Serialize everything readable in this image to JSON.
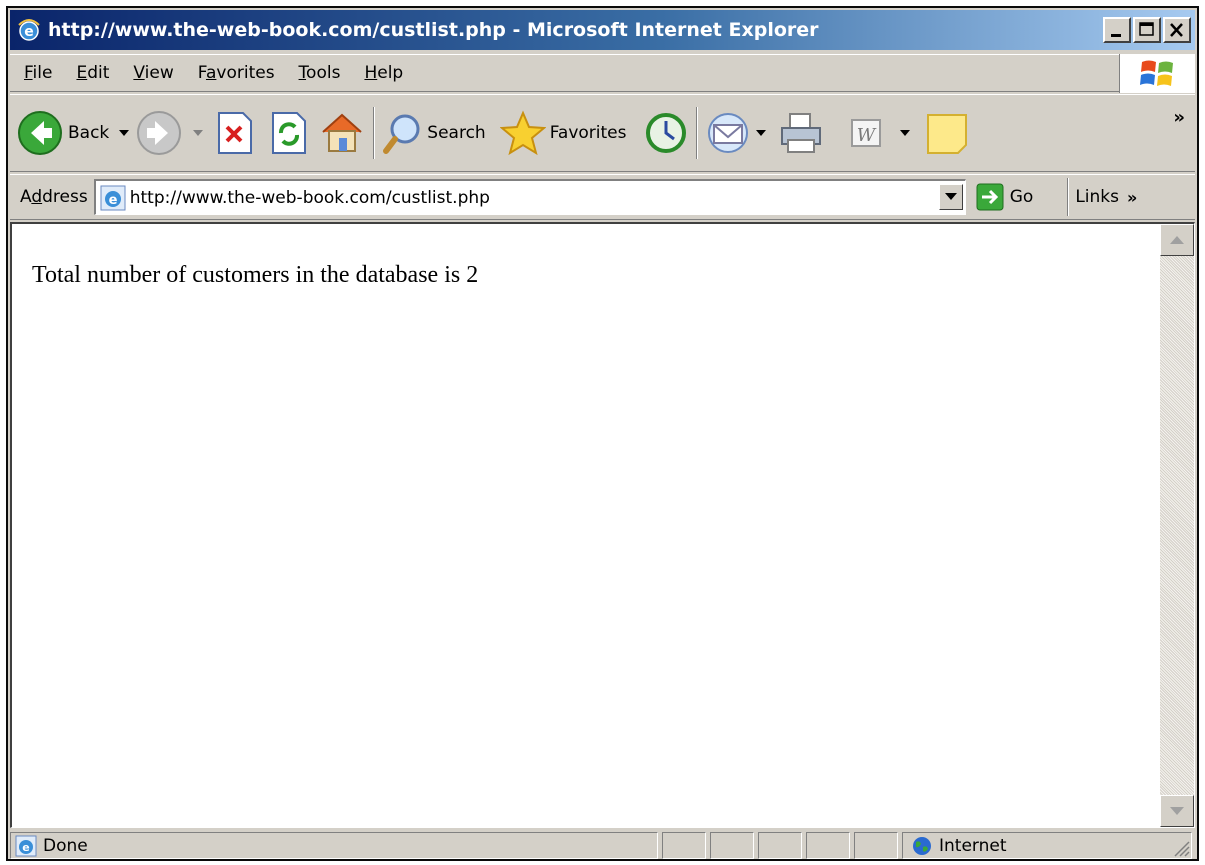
{
  "window": {
    "title": "http://www.the-web-book.com/custlist.php - Microsoft Internet Explorer"
  },
  "menu": {
    "items": [
      {
        "label_pre": "",
        "label_key": "F",
        "label_post": "ile"
      },
      {
        "label_pre": "",
        "label_key": "E",
        "label_post": "dit"
      },
      {
        "label_pre": "",
        "label_key": "V",
        "label_post": "iew"
      },
      {
        "label_pre": "F",
        "label_key": "a",
        "label_post": "vorites"
      },
      {
        "label_pre": "",
        "label_key": "T",
        "label_post": "ools"
      },
      {
        "label_pre": "",
        "label_key": "H",
        "label_post": "elp"
      }
    ]
  },
  "toolbar": {
    "back_label": "Back",
    "search_label": "Search",
    "favorites_label": "Favorites",
    "overflow": "»"
  },
  "address": {
    "label_pre": "A",
    "label_key": "d",
    "label_post": "dress",
    "url": "http://www.the-web-book.com/custlist.php",
    "go_label": "Go",
    "links_label": "Links",
    "links_overflow": "»"
  },
  "page": {
    "text": "Total number of customers in the database is 2"
  },
  "status": {
    "text": "Done",
    "zone": "Internet"
  },
  "colors": {
    "title_start": "#0a246a",
    "title_end": "#a6caf0",
    "chrome": "#d4d0c8"
  }
}
